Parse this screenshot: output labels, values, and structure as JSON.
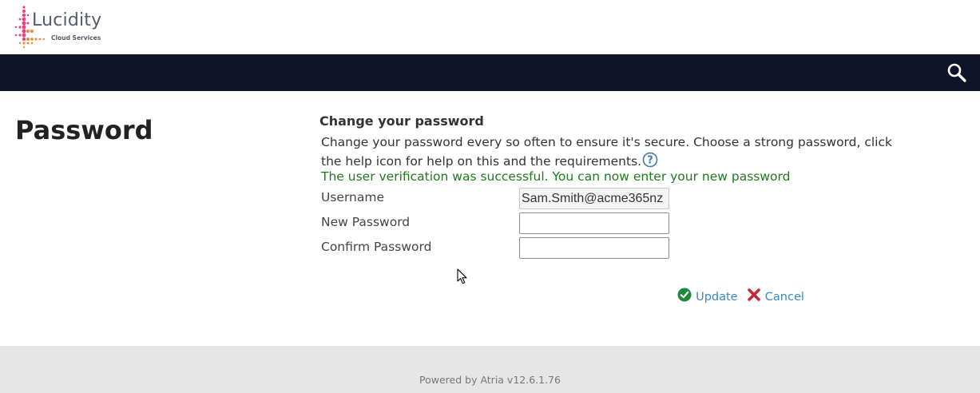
{
  "header": {
    "logo_name": "Lucidity",
    "logo_subtitle": "Cloud Services",
    "search_icon": "search-icon",
    "nav_color": "#0f1428"
  },
  "page": {
    "title": "Password"
  },
  "form": {
    "section_title": "Change your password",
    "description": "Change your password every so often to ensure it's secure. Choose a strong password, click the help icon for help on this and the requirements.",
    "help_icon": "help-icon",
    "success_message": "The user verification was successful. You can now enter your new password",
    "success_color": "#1b7c1b",
    "fields": [
      {
        "label": "Username",
        "value": "Sam.Smith@acme365nz"
      },
      {
        "label": "New Password",
        "value": ""
      },
      {
        "label": "Confirm Password",
        "value": ""
      }
    ],
    "update_label": "Update",
    "cancel_label": "Cancel",
    "update_icon": "check-circle-icon",
    "cancel_icon": "close-icon",
    "link_color": "#3a88c0"
  },
  "footer": {
    "text": "Powered by Atria v12.6.1.76"
  }
}
